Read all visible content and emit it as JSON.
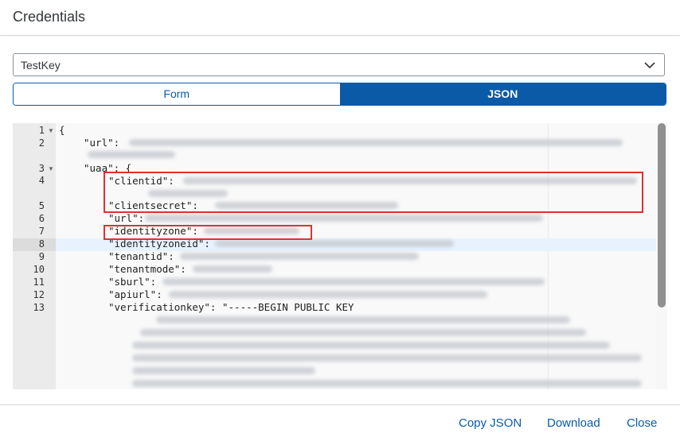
{
  "dialog": {
    "title": "Credentials"
  },
  "key_select": {
    "value": "TestKey"
  },
  "view_toggle": {
    "form_label": "Form",
    "json_label": "JSON",
    "selected": "JSON"
  },
  "editor": {
    "lines": [
      {
        "num": "1",
        "text": "{"
      },
      {
        "num": "2",
        "text": "\"url\":"
      },
      {
        "num": "3",
        "text": "\"uaa\": {"
      },
      {
        "num": "4",
        "text": "\"clientid\":"
      },
      {
        "num": "5",
        "text": "\"clientsecret\":"
      },
      {
        "num": "6",
        "text": "\"url\":"
      },
      {
        "num": "7",
        "text": "\"identityzone\":"
      },
      {
        "num": "8",
        "text": "\"identityzoneid\":"
      },
      {
        "num": "9",
        "text": "\"tenantid\":"
      },
      {
        "num": "10",
        "text": "\"tenantmode\":"
      },
      {
        "num": "11",
        "text": "\"sburl\":"
      },
      {
        "num": "12",
        "text": "\"apiurl\":"
      },
      {
        "num": "13",
        "text": "\"verificationkey\": \"-----BEGIN PUBLIC KEY"
      }
    ]
  },
  "footer": {
    "copy_json": "Copy JSON",
    "download": "Download",
    "close": "Close"
  },
  "colors": {
    "accent": "#0a5aa8",
    "highlight_box": "#e03131"
  }
}
